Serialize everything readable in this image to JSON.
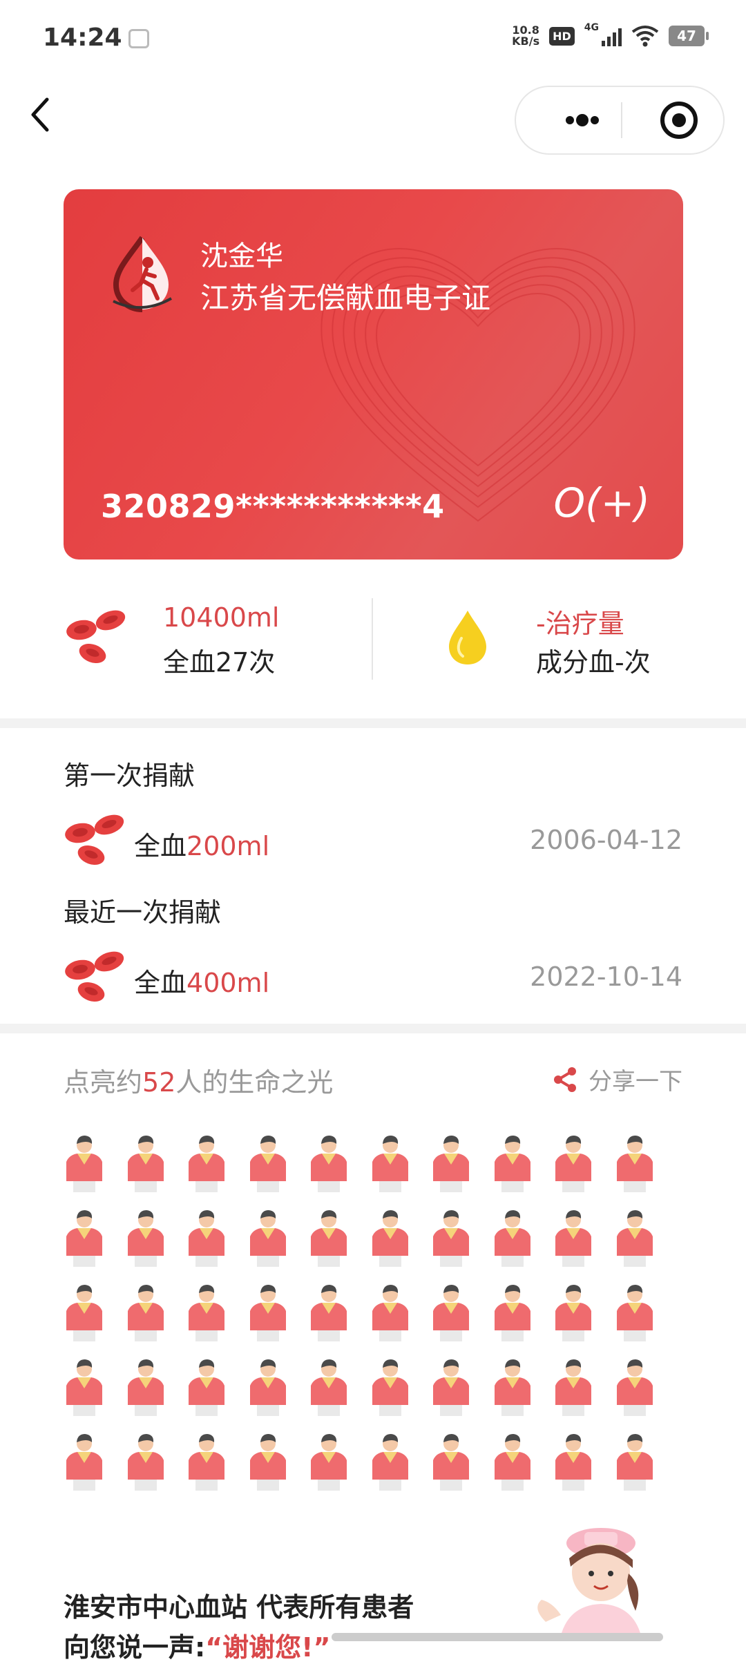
{
  "status_bar": {
    "time": "14:24",
    "net_speed_value": "10.8",
    "net_speed_unit": "KB/s",
    "hd_badge": "HD",
    "network": "4G",
    "battery": "47"
  },
  "nav": {
    "back_icon": "chevron-left-icon",
    "more_icon": "more-dots-icon",
    "close_icon": "target-icon"
  },
  "card": {
    "name": "沈金华",
    "title": "江苏省无偿献血电子证",
    "id_number": "320829***********4",
    "blood_type": "O(+)",
    "colors": {
      "background": "#e33d3f",
      "text": "#ffffff"
    }
  },
  "stats": {
    "whole_blood_amount": "10400ml",
    "whole_blood_label": "全血27次",
    "component_amount": "-治疗量",
    "component_label": "成分血-次"
  },
  "donations": {
    "first_label": "第一次捐献",
    "first": {
      "type": "全血",
      "amount": "200ml",
      "date": "2006-04-12"
    },
    "latest_label": "最近一次捐献",
    "latest": {
      "type": "全血",
      "amount": "400ml",
      "date": "2022-10-14"
    }
  },
  "lights": {
    "prefix": "点亮约",
    "count": "52",
    "suffix": "人的生命之光",
    "share_label": "分享一下",
    "people_shown": 50
  },
  "thanks": {
    "line1": "淮安市中心血站 代表所有患者",
    "line2_prefix": "向您说一声:",
    "line2_highlight": "“谢谢您!”"
  },
  "colors": {
    "accent": "#d9484a",
    "muted": "#999999",
    "separator": "#f2f2f2"
  }
}
